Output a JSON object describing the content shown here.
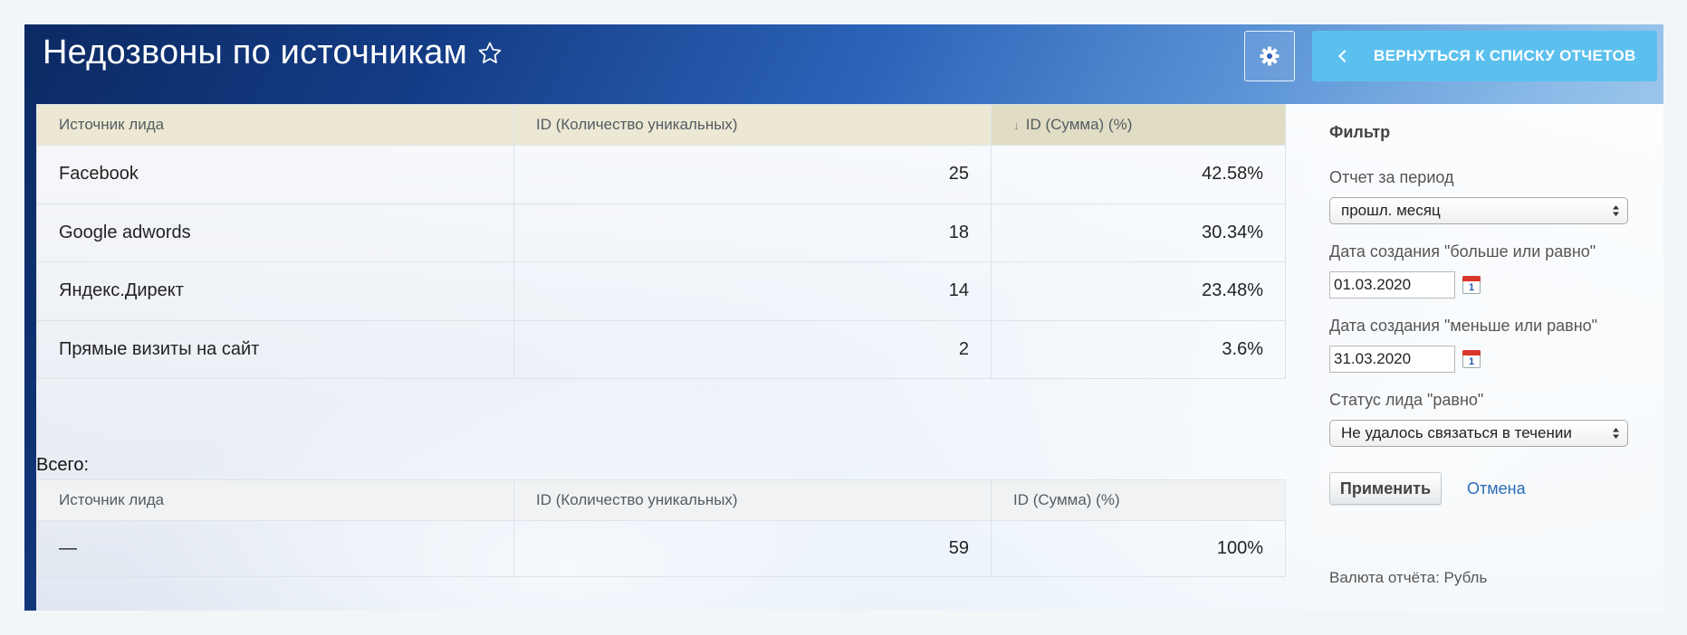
{
  "header": {
    "title": "Недозвоны по источникам",
    "back_button_label": "ВЕРНУТЬСЯ К СПИСКУ ОТЧЕТОВ"
  },
  "report_table": {
    "columns": [
      "Источник лида",
      "ID (Количество уникальных)",
      "ID (Сумма) (%)"
    ],
    "sort_indicator": "↓",
    "rows": [
      {
        "source": "Facebook",
        "count": "25",
        "percent": "42.58%"
      },
      {
        "source": "Google adwords",
        "count": "18",
        "percent": "30.34%"
      },
      {
        "source": "Яндекс.Директ",
        "count": "14",
        "percent": "23.48%"
      },
      {
        "source": "Прямые визиты на сайт",
        "count": "2",
        "percent": "3.6%"
      }
    ]
  },
  "totals": {
    "label": "Всего:",
    "columns": [
      "Источник лида",
      "ID (Количество уникальных)",
      "ID (Сумма) (%)"
    ],
    "row": {
      "source": "—",
      "count": "59",
      "percent": "100%"
    }
  },
  "filter": {
    "title": "Фильтр",
    "period_label": "Отчет за период",
    "period_value": "прошл. месяц",
    "date_from_label": "Дата создания \"больше или равно\"",
    "date_from_value": "01.03.2020",
    "date_to_label": "Дата создания \"меньше или равно\"",
    "date_to_value": "31.03.2020",
    "calendar_day": "1",
    "status_label": "Статус лида \"равно\"",
    "status_value": "Не удалось связаться в течении",
    "apply_label": "Применить",
    "cancel_label": "Отмена",
    "currency_text": "Валюта отчёта: Рубль"
  },
  "colors": {
    "back_button": "#5cc0ef",
    "header_sorted_bg": "#e1ddc4",
    "header_bg": "#ece8d3",
    "link": "#2a6db5"
  },
  "icons": {
    "favorite": "star-outline-icon",
    "settings": "gear-icon",
    "back": "chevron-left-icon",
    "calendar": "calendar-icon",
    "select": "select-arrows-icon"
  }
}
